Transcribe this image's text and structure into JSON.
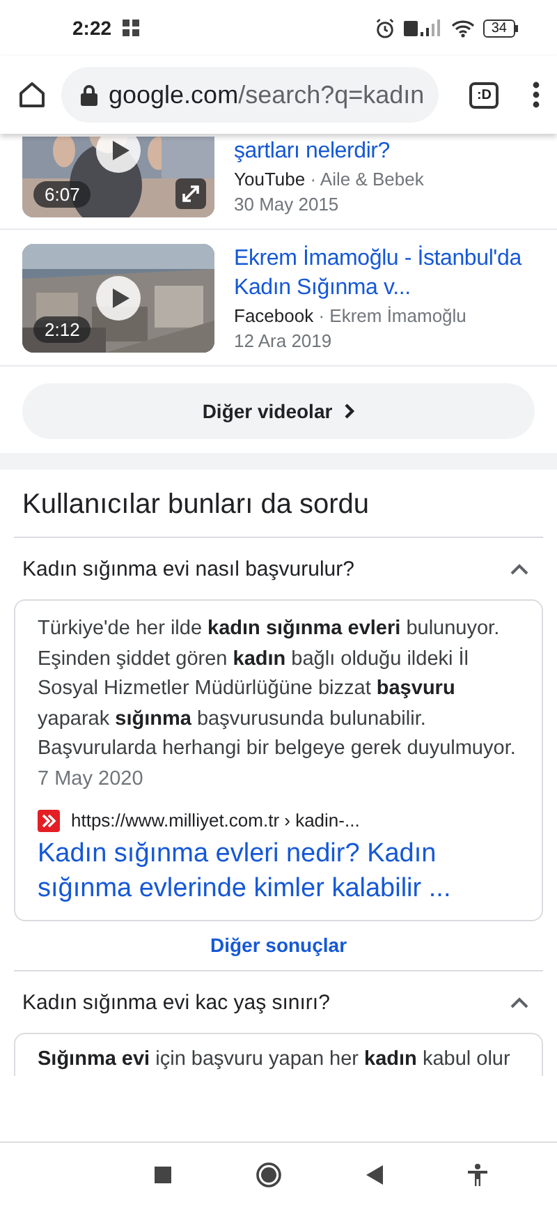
{
  "status_bar": {
    "time": "2:22",
    "battery": "34"
  },
  "toolbar": {
    "url_host": "google.com",
    "url_path": "/search?q=kadın",
    "tabs_label": ":D"
  },
  "videos": [
    {
      "title": "şartları nelerdir?",
      "source": "YouTube",
      "channel": "· Aile & Bebek",
      "date": "30 May 2015",
      "duration": "6:07",
      "expandable": true
    },
    {
      "title": "Ekrem İmamoğlu - İstanbul'da Kadın Sığınma v...",
      "source": "Facebook",
      "channel": "· Ekrem İmamoğlu",
      "date": "12 Ara 2019",
      "duration": "2:12"
    }
  ],
  "more_videos": "Diğer videolar",
  "people_also_ask": {
    "heading": "Kullanıcılar bunları da sordu",
    "questions": [
      {
        "question": "Kadın sığınma evi nasıl başvurulur?",
        "expanded": true,
        "answer": {
          "snippet": "Türkiye'de her ilde **kadın sığınma evleri** bulunuyor. Eşinden şiddet gören **kadın** bağlı olduğu ildeki İl Sosyal Hizmetler Müdürlüğüne bizzat **başvuru** yaparak **sığınma** başvurusunda bulunabilir. Başvurularda herhangi bir belgeye gerek duyulmuyor.",
          "date": "7 May 2020",
          "url": "https://www.milliyet.com.tr › kadin-...",
          "link": "Kadın sığınma evleri nedir? Kadın sığınma evlerinde kimler kalabilir ..."
        },
        "more": "Diğer sonuçlar"
      },
      {
        "question": "Kadın sığınma evi kac yaş sınırı?",
        "expanded": true,
        "answer": {
          "snippet": "**Sığınma evi** için başvuru yapan her **kadın** kabul olur"
        }
      }
    ]
  }
}
